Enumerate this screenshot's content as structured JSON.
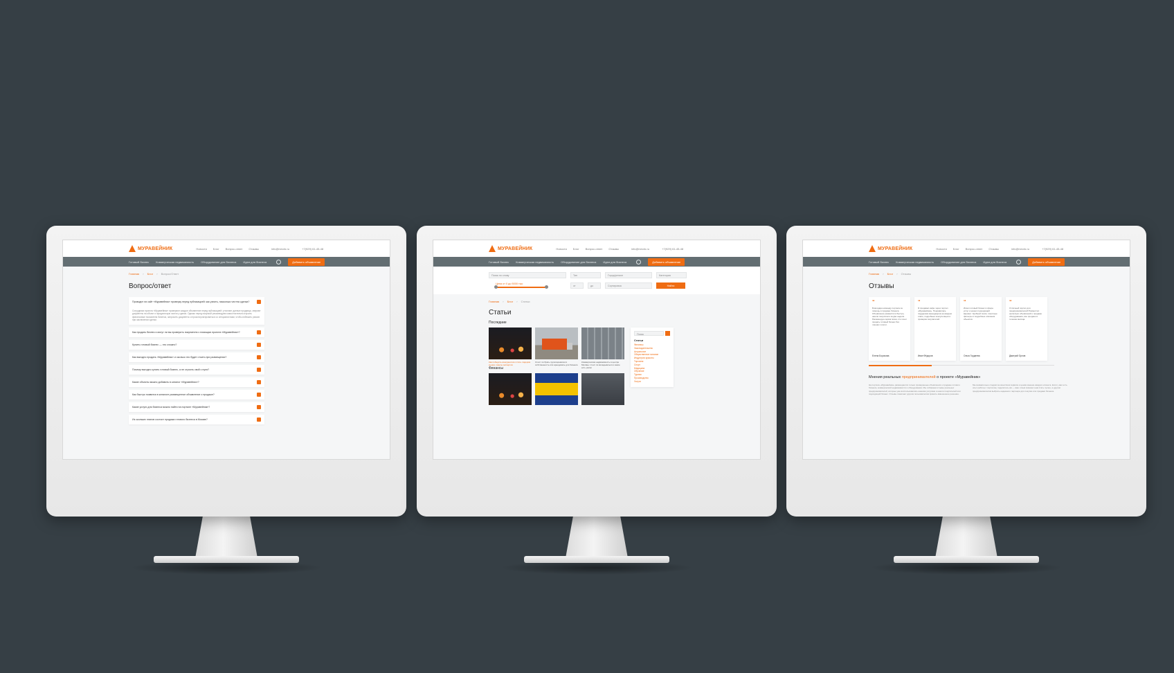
{
  "brand": {
    "name": "МУРАВЕЙНИК",
    "accent": "#ef6c12",
    "nav_bg": "#636e72",
    "bg": "#363f45"
  },
  "header": {
    "top_links": [
      "Новости",
      "Блог",
      "Вопрос-ответ",
      "Отзывы"
    ],
    "email": "info@mrvnk.ru",
    "phone": "+7(929) 61-45-48",
    "nav": [
      "Готовый бизнес",
      "Коммерческая недвижимость",
      "Оборудование для бизнеса",
      "Идеи для бизнеса"
    ],
    "add_button": "Добавить объявление",
    "icon": "user-icon"
  },
  "faq_page": {
    "crumbs": [
      "Главная",
      "Блог",
      "Вопрос/Ответ"
    ],
    "title": "Вопрос/ответ",
    "items": [
      {
        "q": "Проводит ли сайт «Муравейник» проверку перед публикацией: как узнать, насколько честна сделка?",
        "a": "Сотрудники проекта «Муравейник» проверяют каждое объявление перед публикацией: уточняют данные продавца, сверяют документы на объект и юридическую чистоту сделки. Однако перед покупкой рекомендуем самостоятельно изучить финансовые показатели бизнеса, запросить документы и проконсультироваться со специалистами, чтобы избежать рисков при заключении сделки."
      },
      {
        "q": "Как продать бизнес и могут ли вы проверить покупателя с помощью проекта «Муравейник»?"
      },
      {
        "q": "Купить готовый бизнес — это сложно?"
      },
      {
        "q": "Как выгодно продать «Муравейник» и сколько это будет стоить при размещении?"
      },
      {
        "q": "Почему выгодно купить готовый бизнес, а не строить свой с нуля?"
      },
      {
        "q": "Какие объекты можно добавить в каталог «Муравейник»?"
      },
      {
        "q": "Как быстро появится в каталоге размещенное объявление о продаже?"
      },
      {
        "q": "Какие услуги для бизнеса можно найти на портале «Муравейник»?"
      },
      {
        "q": "Из скольких этапов состоит продажа готового бизнеса в Москве?"
      }
    ]
  },
  "articles_page": {
    "filter": {
      "search_placeholder": "Поиск по слову",
      "type": "Тип",
      "city": "Город/регион",
      "category": "Категория",
      "price_label": "Цена от 0 до 5000 тыс",
      "area_from": "от",
      "area_to": "до",
      "sort": "Сортировка",
      "find_button": "Найти"
    },
    "crumbs": [
      "Главная",
      "Блог",
      "Статьи"
    ],
    "title": "Статьи",
    "section_latest": "Последние",
    "section_finance": "Финансы",
    "latest": [
      {
        "caption": "Как победить конкурентов и стать лидером рынка: советы экспертов",
        "accent": true
      },
      {
        "caption": "Стоит ли брать грузоперевозки в собственность или арендовать для бизнеса",
        "accent": false
      },
      {
        "caption": "Коммерческая недвижимость в центре Москвы: стоит ли вкладываться и какие есть риски",
        "accent": false
      }
    ],
    "sidebar": {
      "search_placeholder": "Поиск",
      "title": "Статьи",
      "links": [
        "Финансы",
        "Законодательство",
        "Актуальное",
        "Общественное питание",
        "Индустрия красоты",
        "Торговля",
        "Спорт",
        "Медицина",
        "Обучение",
        "Туризм",
        "Производство",
        "Услуги"
      ]
    }
  },
  "reviews_page": {
    "crumbs": [
      "Главная",
      "Блог",
      "Отзывы"
    ],
    "title": "Отзывы",
    "reviews": [
      {
        "text": "Благодарю команду портала за помощь в продаже бизнеса. Объявление разместили быстро, нашли покупателя за две недели. Рекомендую сервис всем, кто хочет продать готовый бизнес без лишних хлопот.",
        "author": "Елена Борисова"
      },
      {
        "text": "Я продавал кафе через портал «Муравейник». Понравилась поддержка менеджеров на каждом этапе, подробные консультации и проверка покупателей.",
        "author": "Иван Фёдоров"
      },
      {
        "text": "Искал готовый бизнес в сфере услуг и нашел подходящий вариант. Удобный поиск, понятные фильтры и подробные описания объектов.",
        "author": "Ольга Гордеева"
      },
      {
        "text": "Отличный портал для предпринимателей! Разместил несколько объявлений о продаже оборудования, все продано в течение месяца.",
        "author": "Дмитрий Орлов"
      }
    ],
    "progress": 0.34,
    "opinions_title_start": "Мнения реальных ",
    "opinions_title_hl": "предпринимателей",
    "opinions_title_end": " о проекте «Муравейник»",
    "col1": "На портале «Муравейник» размещаются только проверенные объявления о продаже готового бизнеса, коммерческой недвижимости и оборудования. Мы собираем отзывы реальных предпринимателей, которые уже воспользовались нашими услугами и нашли покупателей или подходящий бизнес. Отзывы помогают другим пользователям принять взвешенное решение.",
    "col2": "Мы внимательно следим за качеством сервиса и ценим мнение каждого клиента. Если у вас есть опыт работы с порталом, поделитесь им — ваш отзыв поможет нам стать лучше, а другим предпринимателям выбрать надежного партнера для покупки или продажи бизнеса."
  }
}
